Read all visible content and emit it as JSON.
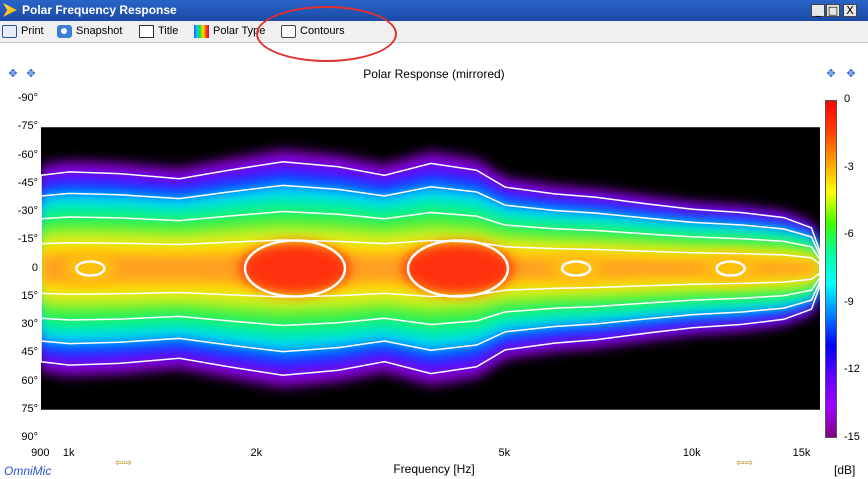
{
  "window": {
    "title": "Polar Frequency Response",
    "controls": [
      "_",
      "□",
      "X"
    ]
  },
  "toolbar": {
    "print": "Print",
    "snapshot": "Snapshot",
    "title": "Title",
    "polar_type": "Polar Type",
    "contours": "Contours"
  },
  "chart_data": {
    "type": "heatmap",
    "title": "Polar Response (mirrored)",
    "xlabel": "Frequency [Hz]",
    "ylabel": "",
    "x_scale": "log",
    "xlim": [
      900,
      16000
    ],
    "ylim": [
      -90,
      90
    ],
    "x_ticks": [
      "900",
      "1k",
      "2k",
      "5k",
      "10k",
      "15k"
    ],
    "x_tick_values": [
      900,
      1000,
      2000,
      5000,
      10000,
      15000
    ],
    "y_ticks": [
      "-90°",
      "-75°",
      "-60°",
      "-45°",
      "-30°",
      "-15°",
      "0",
      "15°",
      "30°",
      "45°",
      "60°",
      "75°",
      "90°"
    ],
    "y_tick_values": [
      -90,
      -75,
      -60,
      -45,
      -30,
      -15,
      0,
      15,
      30,
      45,
      60,
      75,
      90
    ],
    "colorbar": {
      "label": "[dB]",
      "ticks": [
        "0",
        "-3",
        "-6",
        "-9",
        "-12",
        "-15"
      ],
      "range": [
        -15,
        0
      ]
    },
    "data_angle_range": [
      -75,
      75
    ],
    "contour_color": "#ffffff",
    "hot_spots": [
      {
        "freq": 1080,
        "angle": 0,
        "db": -5
      },
      {
        "freq": 2300,
        "angle": 0,
        "db": -1
      },
      {
        "freq": 4200,
        "angle": 0,
        "db": -0.5
      },
      {
        "freq": 6500,
        "angle": 0,
        "db": -4
      },
      {
        "freq": 11500,
        "angle": 0,
        "db": -6
      }
    ]
  },
  "footer": {
    "brand": "OmniMic"
  }
}
